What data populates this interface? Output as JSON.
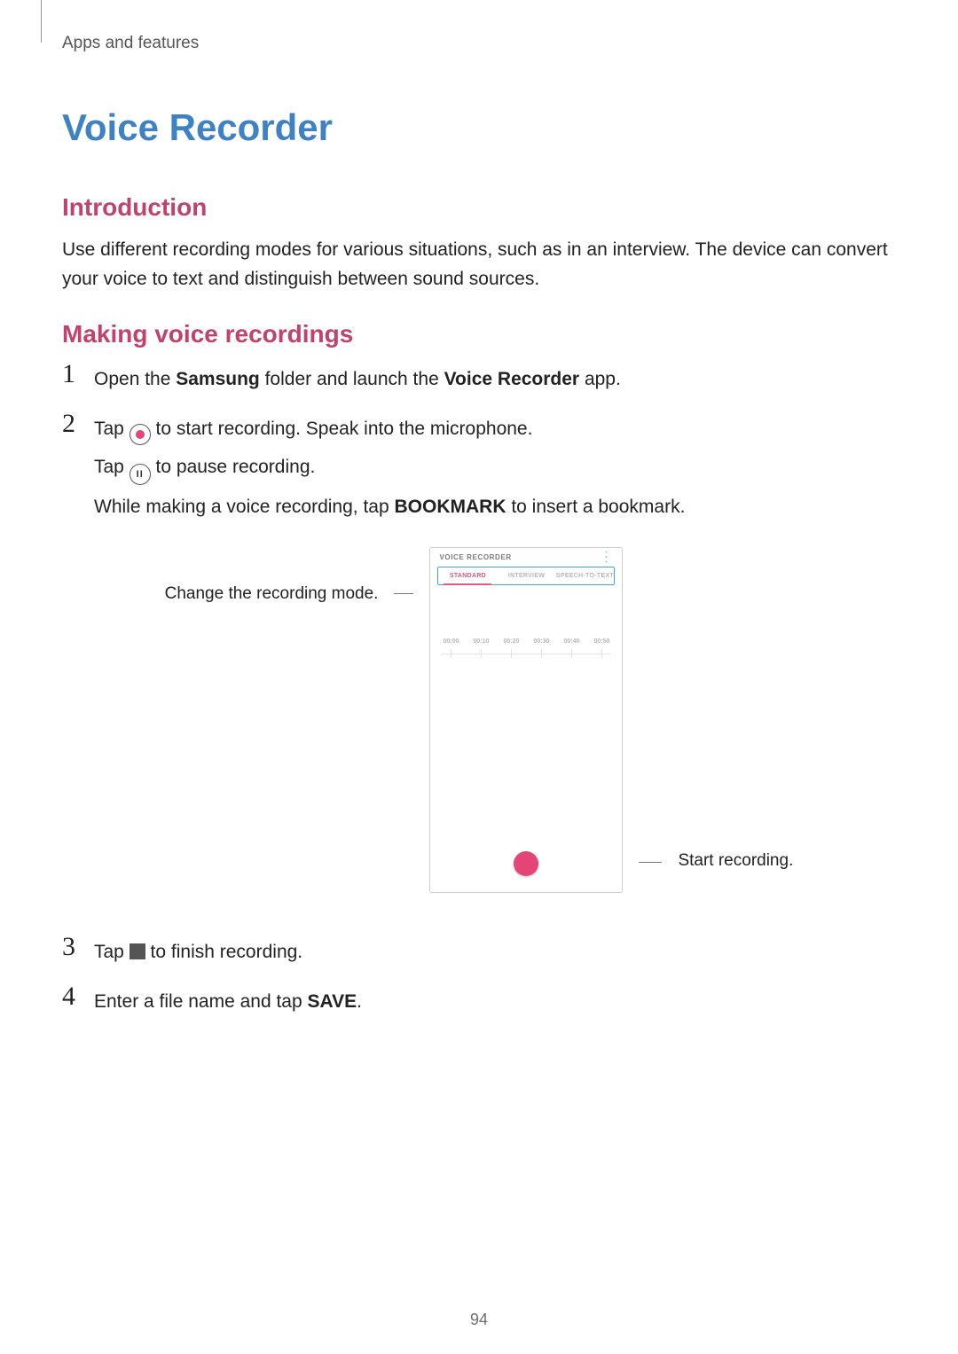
{
  "running_head": "Apps and features",
  "page_title": "Voice Recorder",
  "intro": {
    "heading": "Introduction",
    "body": "Use different recording modes for various situations, such as in an interview. The device can convert your voice to text and distinguish between sound sources."
  },
  "recording": {
    "heading": "Making voice recordings",
    "steps": [
      {
        "num": "1",
        "pieces": [
          "Open the ",
          "Samsung",
          " folder and launch the ",
          "Voice Recorder",
          " app."
        ]
      },
      {
        "num": "2",
        "line_a": [
          "Tap ",
          "record-icon",
          " to start recording. Speak into the microphone."
        ],
        "line_b": [
          "Tap ",
          "pause-icon",
          " to pause recording."
        ],
        "line_c": [
          "While making a voice recording, tap ",
          "BOOKMARK",
          " to insert a bookmark."
        ]
      },
      {
        "num": "3",
        "pieces": [
          "Tap ",
          "stop-icon",
          " to finish recording."
        ]
      },
      {
        "num": "4",
        "pieces": [
          "Enter a file name and tap ",
          "SAVE",
          "."
        ]
      }
    ]
  },
  "figure": {
    "callout_left": "Change the recording mode.",
    "callout_right": "Start recording.",
    "app_title": "VOICE RECORDER",
    "tabs": [
      "STANDARD",
      "INTERVIEW",
      "SPEECH-TO-TEXT"
    ],
    "ticks": [
      "00:00",
      "00:10",
      "00:20",
      "00:30",
      "00:40",
      "00:50"
    ]
  },
  "page_number": "94"
}
